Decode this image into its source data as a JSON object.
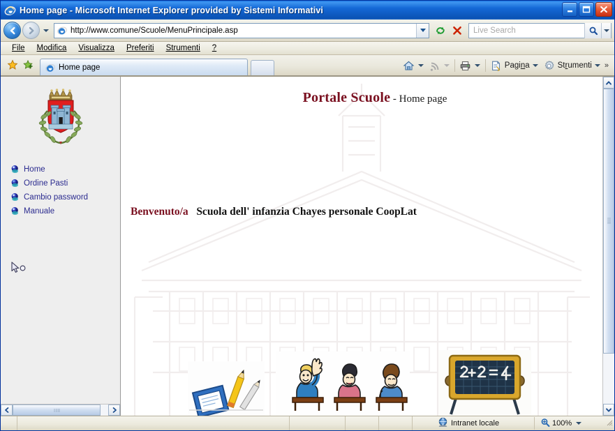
{
  "window": {
    "title": "Home page - Microsoft Internet Explorer provided by Sistemi Informativi",
    "logo_icon": "ie-logo-icon",
    "minimize_label": "Riduci a icona",
    "maximize_label": "Ingrandisci",
    "close_label": "Chiudi",
    "minimize_icon": "minimize-icon",
    "maximize_icon": "maximize-icon",
    "close_icon": "close-icon"
  },
  "navbar": {
    "back_icon": "back-arrow-icon",
    "forward_icon": "forward-arrow-icon",
    "history_dropdown_icon": "chevron-down-icon",
    "address": {
      "icon": "page-icon",
      "value": "http://www.comune/Scuole/MenuPrincipale.asp",
      "dropdown_icon": "chevron-down-icon"
    },
    "refresh_icon": "refresh-icon",
    "stop_icon": "stop-icon",
    "search": {
      "placeholder": "Live Search",
      "value": "",
      "go_icon": "search-icon",
      "provider_dropdown_icon": "chevron-down-icon"
    }
  },
  "menubar": {
    "items": [
      {
        "label": "File"
      },
      {
        "label": "Modifica"
      },
      {
        "label": "Visualizza"
      },
      {
        "label": "Preferiti"
      },
      {
        "label": "Strumenti"
      },
      {
        "label": "?"
      }
    ]
  },
  "tabbar": {
    "favorites_icon": "favorites-star-icon",
    "add_favorite_icon": "add-favorite-icon",
    "tab": {
      "label": "Home page",
      "icon": "ie-logo-icon"
    },
    "new_tab_label": "",
    "commands": {
      "home_label": "",
      "home_icon": "home-icon",
      "feeds_icon": "rss-feed-icon",
      "print_icon": "printer-icon",
      "page_label": "Pagina",
      "page_icon": "page-tools-icon",
      "tools_label": "Strumenti",
      "tools_icon": "gear-icon",
      "overflow_label": "»"
    }
  },
  "sidebar": {
    "crest_icon": "municipal-coat-of-arms-icon",
    "items": [
      {
        "label": "Home",
        "icon": "bullet-sphere-icon"
      },
      {
        "label": "Ordine Pasti",
        "icon": "bullet-sphere-icon"
      },
      {
        "label": "Cambio password",
        "icon": "bullet-sphere-icon"
      },
      {
        "label": "Manuale",
        "icon": "bullet-sphere-icon"
      }
    ],
    "cursor_icon": "mouse-pointer-icon",
    "scroll_left_icon": "chevron-left-icon",
    "scroll_right_icon": "chevron-right-icon"
  },
  "page": {
    "title": "Portale Scuole",
    "subtitle": " - Home page",
    "welcome_prefix": "Benvenuto/a",
    "welcome_user": "Scuola dell' infanzia Chayes personale CoopLat",
    "watermark_icon": "palazzo-building-watermark",
    "images": [
      {
        "name": "books-and-pencils-image"
      },
      {
        "name": "students-at-desks-image"
      },
      {
        "name": "blackboard-image",
        "text": "2+2=4"
      }
    ],
    "scroll_up_icon": "chevron-up-icon",
    "scroll_down_icon": "chevron-down-icon"
  },
  "statusbar": {
    "message": "",
    "zone_icon": "internet-zone-icon",
    "zone_label": "Intranet locale",
    "zoom_icon": "zoom-magnifier-icon",
    "zoom_label": "100%",
    "zoom_dropdown_icon": "chevron-down-icon"
  },
  "colors": {
    "titlebar_blue": "#0a5fcc",
    "portal_red": "#7a1020",
    "link_navy": "#2b2b8f",
    "chrome_beige": "#ece9dd"
  }
}
